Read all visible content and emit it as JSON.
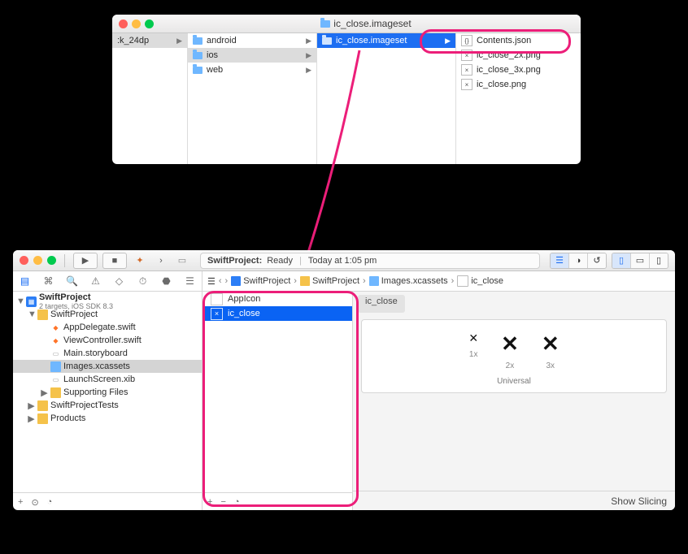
{
  "finder": {
    "title": "ic_close.imageset",
    "columns": [
      [
        {
          "name": ":k_24dp"
        }
      ],
      [
        {
          "name": "android"
        },
        {
          "name": "ios"
        },
        {
          "name": "web"
        }
      ],
      [
        {
          "name": "ic_close.imageset"
        }
      ],
      [
        {
          "name": "Contents.json"
        },
        {
          "name": "ic_close_2x.png"
        },
        {
          "name": "ic_close_3x.png"
        },
        {
          "name": "ic_close.png"
        }
      ]
    ]
  },
  "xcode": {
    "status": {
      "project": "SwiftProject:",
      "state": "Ready",
      "time": "Today at 1:05 pm"
    },
    "tree": [
      {
        "label": "SwiftProject",
        "sub": "2 targets, iOS SDK 8.3"
      },
      {
        "label": "SwiftProject"
      },
      {
        "label": "AppDelegate.swift"
      },
      {
        "label": "ViewController.swift"
      },
      {
        "label": "Main.storyboard"
      },
      {
        "label": "Images.xcassets"
      },
      {
        "label": "LaunchScreen.xib"
      },
      {
        "label": "Supporting Files"
      },
      {
        "label": "SwiftProjectTests"
      },
      {
        "label": "Products"
      }
    ],
    "jumpbar": [
      "SwiftProject",
      "SwiftProject",
      "Images.xcassets",
      "ic_close"
    ],
    "assets": [
      "AppIcon",
      "ic_close"
    ],
    "canvas": {
      "breadcrumb": "ic_close",
      "slots": [
        "1x",
        "2x",
        "3x"
      ],
      "idiom": "Universal",
      "slicing": "Show Slicing"
    }
  },
  "annotation": {
    "color": "#ec1e79"
  }
}
